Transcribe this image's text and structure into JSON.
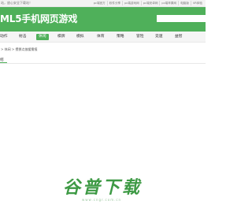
{
  "topbar": {
    "notice": "站，放心安全下载站！",
    "links": [
      "pc端官方",
      "软件分享",
      "pc端游戏网",
      "pc端安卓网",
      "pc端苹果网",
      "电脑版",
      "VR体验"
    ]
  },
  "header": {
    "logo": "ML5手机网页游戏",
    "search_placeholder": ""
  },
  "nav": {
    "items": [
      {
        "label": "动作",
        "active": false
      },
      {
        "label": "射击",
        "active": false
      },
      {
        "label": "休闲",
        "active": true
      },
      {
        "label": "棋牌",
        "active": false
      },
      {
        "label": "模拟",
        "active": false
      },
      {
        "label": "体育",
        "active": false
      },
      {
        "label": "策略",
        "active": false
      },
      {
        "label": "冒险",
        "active": false
      },
      {
        "label": "竞速",
        "active": false
      },
      {
        "label": "益智",
        "active": false
      }
    ]
  },
  "breadcrumb": "> 休闲 > 攒挪点放缓需报",
  "section": {
    "tab_label": "绍"
  },
  "watermark": {
    "text": "谷普下载",
    "url": "www.cngr.com.cn"
  },
  "colors": {
    "brand": "#4fb05a",
    "watermark": "#3e9a45"
  }
}
